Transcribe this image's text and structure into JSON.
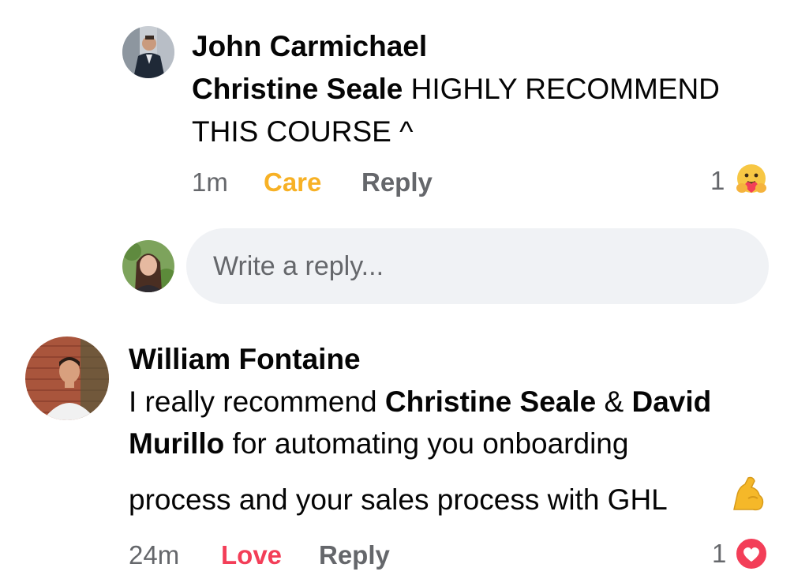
{
  "comments": [
    {
      "author": "John Carmichael",
      "mention": "Christine Seale",
      "text_line1": " HIGHLY RECOMMEND",
      "text_line2": "THIS COURSE ^",
      "time": "1m",
      "reaction_action": "Care",
      "reply_label": "Reply",
      "reaction_count": "1",
      "reaction_icon": "care-reaction-icon"
    },
    {
      "author": "William Fontaine",
      "line1_prefix": "I really recommend ",
      "mention1": "Christine Seale",
      "line1_mid": " & ",
      "mention2_part1": "David",
      "mention2_part2": "Murillo",
      "line2_rest": " for automating you onboarding",
      "line3": "process and your sales process with GHL",
      "line3_emoji": "flexed-biceps-emoji",
      "time": "24m",
      "reaction_action": "Love",
      "reply_label": "Reply",
      "reaction_count": "1",
      "reaction_icon": "love-reaction-icon"
    }
  ],
  "reply_input": {
    "placeholder": "Write a reply..."
  },
  "colors": {
    "care": "#f7b125",
    "love": "#f33e58",
    "meta": "#65676b",
    "input_bg": "#f0f2f5"
  }
}
